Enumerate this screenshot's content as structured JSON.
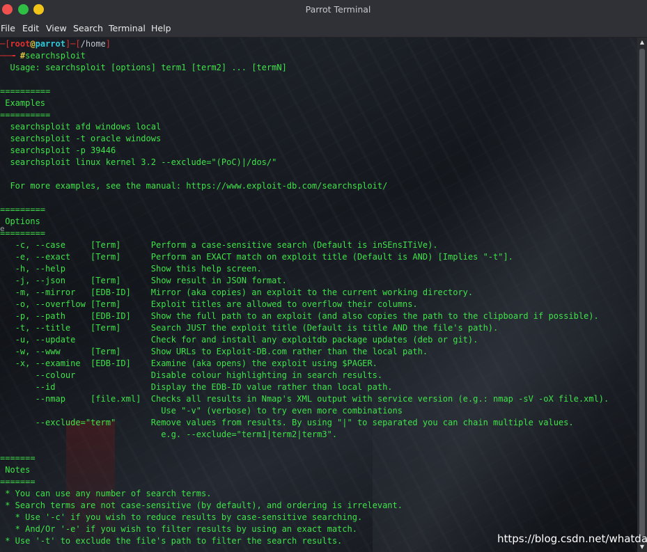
{
  "window": {
    "title": "Parrot Terminal"
  },
  "menu": [
    "File",
    "Edit",
    "View",
    "Search",
    "Terminal",
    "Help"
  ],
  "prompt": {
    "bracket_open": "─[",
    "user": "root",
    "at": "@",
    "host": "parrot",
    "sep": "]─[",
    "path": "/home",
    "bracket_close": "]",
    "arrow": "──╼ ",
    "hash": "#",
    "command": "searchsploit"
  },
  "output": [
    "  Usage: searchsploit [options] term1 [term2] ... [termN]",
    "",
    "==========",
    " Examples",
    "==========",
    "  searchsploit afd windows local",
    "  searchsploit -t oracle windows",
    "  searchsploit -p 39446",
    "  searchsploit linux kernel 3.2 --exclude=\"(PoC)|/dos/\"",
    "",
    "  For more examples, see the manual: https://www.exploit-db.com/searchsploit/",
    "",
    "=========",
    " Options",
    "=========",
    "   -c, --case     [Term]      Perform a case-sensitive search (Default is inSEnsITiVe).",
    "   -e, --exact    [Term]      Perform an EXACT match on exploit title (Default is AND) [Implies \"-t\"].",
    "   -h, --help                 Show this help screen.",
    "   -j, --json     [Term]      Show result in JSON format.",
    "   -m, --mirror   [EDB-ID]    Mirror (aka copies) an exploit to the current working directory.",
    "   -o, --overflow [Term]      Exploit titles are allowed to overflow their columns.",
    "   -p, --path     [EDB-ID]    Show the full path to an exploit (and also copies the path to the clipboard if possible).",
    "   -t, --title    [Term]      Search JUST the exploit title (Default is title AND the file's path).",
    "   -u, --update               Check for and install any exploitdb package updates (deb or git).",
    "   -w, --www      [Term]      Show URLs to Exploit-DB.com rather than the local path.",
    "   -x, --examine  [EDB-ID]    Examine (aka opens) the exploit using $PAGER.",
    "       --colour               Disable colour highlighting in search results.",
    "       --id                   Display the EDB-ID value rather than local path.",
    "       --nmap     [file.xml]  Checks all results in Nmap's XML output with service version (e.g.: nmap -sV -oX file.xml).",
    "                                Use \"-v\" (verbose) to try even more combinations",
    "       --exclude=\"term\"       Remove values from results. By using \"|\" to separated you can chain multiple values.",
    "                                e.g. --exclude=\"term1|term2|term3\".",
    "",
    "=======",
    " Notes",
    "=======",
    " * You can use any number of search terms.",
    " * Search terms are not case-sensitive (by default), and ordering is irrelevant.",
    "   * Use '-c' if you wish to reduce results by case-sensitive searching.",
    "   * And/Or '-e' if you wish to filter results by using an exact match.",
    " * Use '-t' to exclude the file's path to filter the search results."
  ],
  "left_edge_char": "e",
  "watermark": "https://blog.csdn.net/whatday",
  "colors": {
    "text_green": "#3fe34a",
    "prompt_red": "#e03030",
    "prompt_yellow": "#d8c040",
    "prompt_cyan": "#2fc8d8",
    "titlebar": "#2f3136"
  }
}
